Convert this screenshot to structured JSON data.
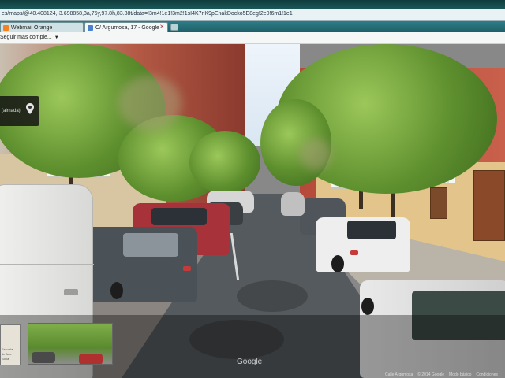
{
  "browser": {
    "url": "es/maps/@40.408124,-3.698858,3a,75y,97.8h,83.88t/data=!3m4!1e1!3m2!1sI4K7nK9pEnakDocko5E8eg!2e0!6m1!1e1",
    "tabs": [
      {
        "label": "Webmail Orange",
        "icon": "webmail-favicon"
      },
      {
        "label": "C/ Argumosa, 17 - Google ...",
        "icon": "google-maps-favicon",
        "active": true
      }
    ],
    "favorites_item": "Seguir más comple...",
    "close_glyph": "✕"
  },
  "streetview": {
    "address_card_label": "(aimada)",
    "watermark": "Google",
    "footer": {
      "street": "Calle Argumosa",
      "copyright": "© 2014 Google",
      "mode": "Modo básico",
      "terms": "Condiciones"
    },
    "minimap_lines": [
      "Escuela",
      "de Arte",
      "Sofía"
    ]
  },
  "colors": {
    "chrome_dark": "#1e5f68",
    "url_bar": "#e8f2f4",
    "tab_active": "#f4f7f8"
  }
}
